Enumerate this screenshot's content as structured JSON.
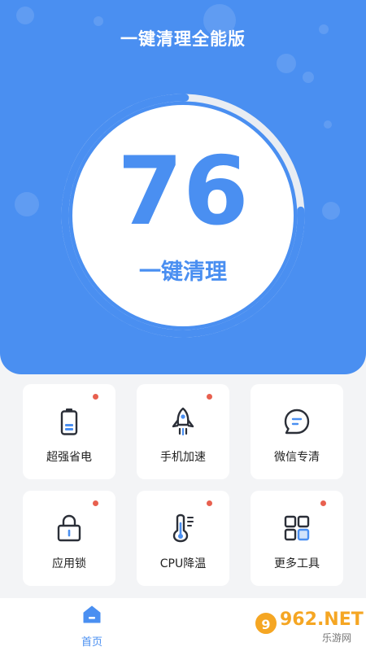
{
  "app": {
    "title": "一键清理全能版"
  },
  "gauge": {
    "score": "76",
    "progress": 0.76,
    "action_label": "一键清理"
  },
  "tools": [
    {
      "label": "超强省电",
      "icon": "battery-icon",
      "badge": true
    },
    {
      "label": "手机加速",
      "icon": "rocket-icon",
      "badge": true
    },
    {
      "label": "微信专清",
      "icon": "chat-bubble-icon",
      "badge": false
    },
    {
      "label": "应用锁",
      "icon": "lock-icon",
      "badge": true
    },
    {
      "label": "CPU降温",
      "icon": "thermometer-icon",
      "badge": true
    },
    {
      "label": "更多工具",
      "icon": "grid-icon",
      "badge": true
    }
  ],
  "tabbar": {
    "home_label": "首页",
    "home_icon": "home-icon"
  },
  "watermark": {
    "number": "962",
    "suffix": ".NET",
    "sub": "乐游网"
  },
  "colors": {
    "primary": "#4a8ff1",
    "badge": "#e8604f",
    "background": "#f3f4f6"
  }
}
